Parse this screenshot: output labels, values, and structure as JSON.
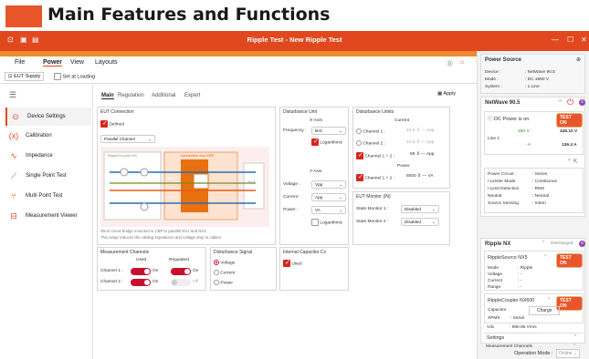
{
  "banner": {
    "title": "Main Features and Functions"
  },
  "window": {
    "title": "Ripple Test - New Ripple Test"
  },
  "menu": [
    "File",
    "Power",
    "View",
    "Layouts"
  ],
  "toolbar": {
    "eut_supply": "EUT Supply",
    "set_loading": "Set at Loading"
  },
  "nav": [
    "Device Settings",
    "Calibration",
    "Impedance",
    "Single Point Test",
    "Multi Point Test",
    "Measurement Viewer"
  ],
  "tabs": [
    "Main",
    "Regulation",
    "Additional",
    "Expert"
  ],
  "apply": "Apply",
  "eut": {
    "title": "EUT Connection",
    "defined": "Defined",
    "mode": "Parallel Channel",
    "coupler": "RippleCoupler NX",
    "box": "connection box CBP",
    "unit1": "UNIT 1",
    "unit2": "UNIT 2",
    "eut": "EUT",
    "note1": "Short circuit bridge mounted in CBP to parallel NV1 and NV2.",
    "note2": "This setup reduces the cabling impedance and voltage drop in cables."
  },
  "dist_unit": {
    "title": "Disturbance Unit",
    "xaxis": "X-Axis",
    "freq_label": "Frequency :",
    "freq_val": "kHz",
    "log1": "Logarithmic",
    "yaxis": "Y-Axis",
    "volt_label": "Voltage :",
    "volt_val": "Vpp",
    "cur_label": "Current :",
    "cur_val": "App",
    "pow_label": "Power :",
    "pow_val": "VA",
    "log2": "Logarithmic"
  },
  "dist_limits": {
    "title": "Disturbance Limits",
    "current": "Current",
    "ch1": "Channel 1 :",
    "ch1_val": "44.5",
    "ch2": "Channel 2 :",
    "ch2_val": "44.5",
    "ch12": "Channel 1 + 2 :",
    "ch12_val": "89",
    "unit_a": "App",
    "power": "Power",
    "pch12": "Channel 1 + 2 :",
    "pch12_val": "5000",
    "unit_va": "VA"
  },
  "eut_monitor": {
    "title": "EUT Monitor (IN)",
    "sm1": "State Monitor 1 :",
    "sm1_val": "Disabled",
    "sm2": "State Monitor 2 :",
    "sm2_val": "Disabled"
  },
  "meas": {
    "title": "Measurement Channels",
    "used": "Used",
    "regulated": "Regulated",
    "ch1": "Channel 1 :",
    "ch2": "Channel 2 :",
    "on": "On",
    "off": "Off"
  },
  "dist_signal": {
    "title": "Disturbance Signal",
    "voltage": "Voltage",
    "current": "Current",
    "power": "Power"
  },
  "int_cap": {
    "title": "Internal Capacitor Cx",
    "used": "Used"
  },
  "right": {
    "power_source": "Power Source",
    "device": "Device :",
    "device_val": ": NetWave 90.5",
    "mode": "Mode :",
    "mode_val": ": DC ±560 V",
    "system": "System :",
    "system_val": ": 1 Line",
    "netwave": "NetWave 90.5",
    "dc_on": "DC Power is on",
    "test_on": "TEST ON",
    "v_set": "450 V :",
    "v_meas": "449.10 V",
    "line1": "Line 1",
    "a_set": "- A :",
    "a_meas": "136.4 A",
    "pc": "Power Circuit :",
    "pc_val": ": Series",
    "lm": "I Limiter Mode",
    "lm_val": ": Continuous",
    "ld": "I Limit Detection",
    "ld_val": ": RMS",
    "neutral": "Neutral",
    "neutral_val": ": Neutral",
    "ss": "Source Sensing",
    "ss_val": ": Intern",
    "ripple_nx": "Ripple NX",
    "discharged": "Discharged",
    "rs": "RippleSource NX5",
    "rs_mode": "Mode",
    "rs_mode_val": ": Ripple",
    "rs_volt": "Voltage",
    "rs_volt_val": ": -",
    "rs_cur": "Current",
    "rs_cur_val": ": -",
    "rs_range": "Range",
    "rs_range_val": ": -",
    "rc": "RippleCoupler NX600",
    "cap": "Capacitor",
    "cap_val": "Charge",
    "xpms": "XPMS",
    "xpms_val": ": Serial",
    "vdc": "Vdc",
    "vdc_val": ": 980.95 Vrms",
    "settings": "Settings",
    "mc": "Measurement Channels",
    "ch1": "Channel 1",
    "ch1_val": ": Regulation",
    "op_mode": "Operation Mode :",
    "op_mode_val": "Online"
  }
}
